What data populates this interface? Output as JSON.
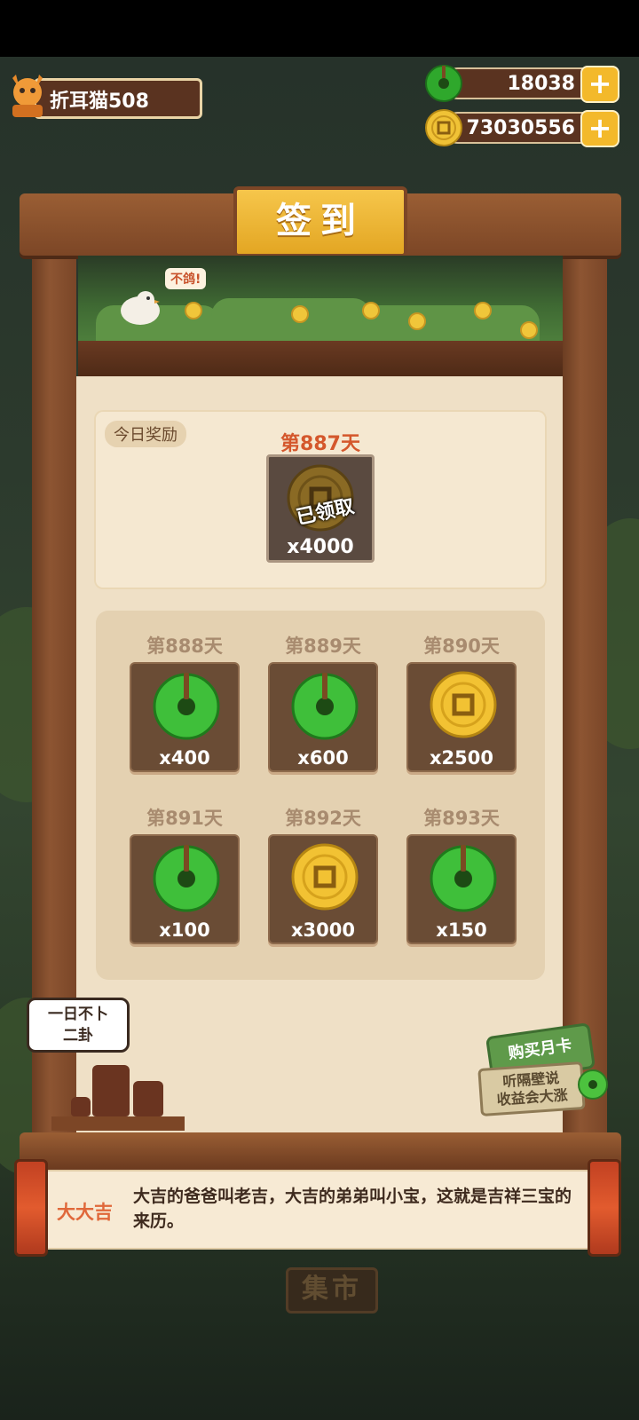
{
  "player": {
    "name": "折耳猫508",
    "avatar_icon": "orange-cat-avatar-icon"
  },
  "resources": {
    "jade": {
      "value": "18038",
      "icon": "jade-coin-icon",
      "plus": "+"
    },
    "coins": {
      "value": "73030556",
      "icon": "gold-coin-icon",
      "plus": "+"
    }
  },
  "signin": {
    "title": "签到",
    "bird_speech": "不鸽!",
    "today": {
      "tag": "今日奖励",
      "day": "第887天",
      "amount": "x4000",
      "reward": "gold-coin",
      "stamp": "已领取"
    },
    "upcoming": [
      {
        "day": "第888天",
        "amount": "x400",
        "reward": "jade"
      },
      {
        "day": "第889天",
        "amount": "x600",
        "reward": "jade"
      },
      {
        "day": "第890天",
        "amount": "x2500",
        "reward": "gold-coin"
      },
      {
        "day": "第891天",
        "amount": "x100",
        "reward": "jade"
      },
      {
        "day": "第892天",
        "amount": "x3000",
        "reward": "gold-coin"
      },
      {
        "day": "第893天",
        "amount": "x150",
        "reward": "jade"
      }
    ]
  },
  "fortune_bubble": {
    "line1": "一日不卜",
    "line2": "二卦"
  },
  "month_card": {
    "button": "购买月卡",
    "sign_line1": "听隔壁说",
    "sign_line2": "收益会大涨"
  },
  "banner": {
    "speaker": "大大吉",
    "message": "大吉的爸爸叫老吉，大吉的弟弟叫小宝，这就是吉祥三宝的来历。"
  },
  "market": "集市",
  "colors": {
    "accent_gold": "#f3b92b",
    "day_red": "#d4572c",
    "jade_green": "#3fbf3a"
  }
}
